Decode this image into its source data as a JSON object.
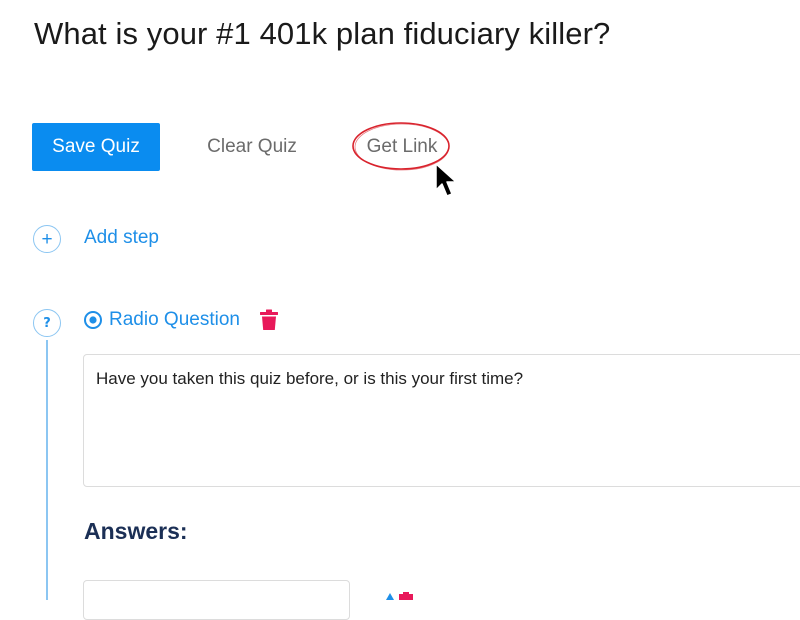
{
  "quiz": {
    "title": "What is your #1 401k plan fiduciary killer?"
  },
  "toolbar": {
    "save_label": "Save Quiz",
    "clear_label": "Clear Quiz",
    "get_link_label": "Get Link"
  },
  "steps": {
    "add_step_label": "Add step",
    "add_icon": "+",
    "question_icon": "?"
  },
  "question": {
    "type_label": "Radio Question",
    "text": "Have you taken this quiz before, or is this your first time?"
  },
  "answers": {
    "heading": "Answers:"
  },
  "colors": {
    "primary": "#0a8cf0",
    "link": "#1e8fe8",
    "delete": "#e8195a",
    "heading": "#1b2f55",
    "annotation": "#d9232d"
  }
}
